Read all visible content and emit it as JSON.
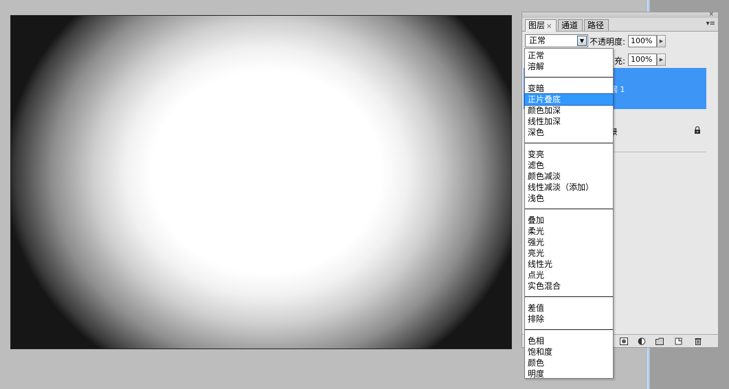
{
  "panel": {
    "tabs": [
      {
        "label": "图层",
        "active": true,
        "close": "×"
      },
      {
        "label": "通道"
      },
      {
        "label": "路径"
      }
    ],
    "panel_close": "×",
    "panel_menu": "▾≡",
    "blend_mode": "正常",
    "opacity_label": "不透明度:",
    "opacity_value": "100%",
    "fill_label": "充:",
    "fill_value": "100%",
    "layers": [
      {
        "name": "层 1",
        "selected": true
      },
      {
        "name": "景",
        "locked": true
      }
    ]
  },
  "blend_menu": {
    "groups": [
      [
        "正常",
        "溶解"
      ],
      [
        "变暗",
        "正片叠底",
        "颜色加深",
        "线性加深",
        "深色"
      ],
      [
        "变亮",
        "滤色",
        "颜色减淡",
        "线性减淡（添加）",
        "浅色"
      ],
      [
        "叠加",
        "柔光",
        "强光",
        "亮光",
        "线性光",
        "点光",
        "实色混合"
      ],
      [
        "差值",
        "排除"
      ],
      [
        "色相",
        "饱和度",
        "颜色",
        "明度"
      ]
    ],
    "highlighted": "正片叠底"
  },
  "colors": {
    "selection": "#3399ff",
    "selected_layer": "#3d95f6",
    "panel_bg": "#e7e7e7",
    "workspace": "#bdbdbd"
  }
}
